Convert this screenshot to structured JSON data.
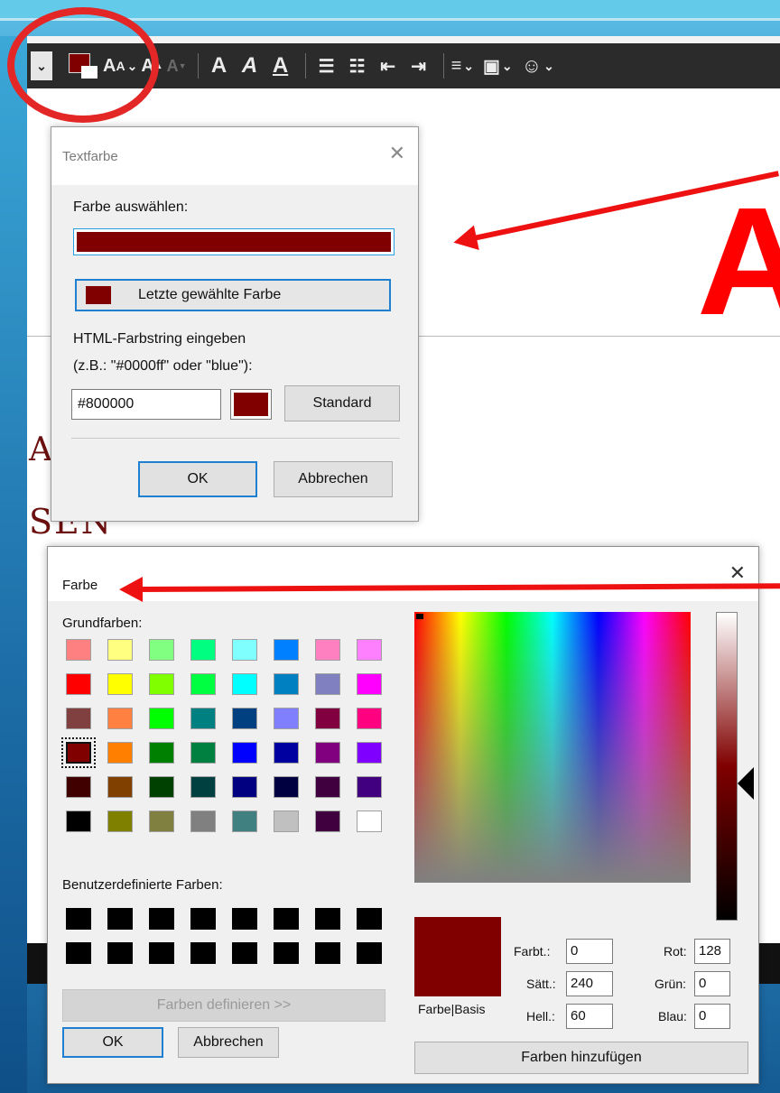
{
  "toolbar": {
    "buttons": [
      "text-color",
      "font-size",
      "grow-font",
      "shrink-font",
      "bold",
      "italic",
      "underline",
      "bullet-list",
      "numbered-list",
      "decrease-indent",
      "increase-indent",
      "align",
      "insert-image",
      "emoji"
    ]
  },
  "background": {
    "big_letter": "A",
    "fragment_1": "A",
    "fragment_2": "SEN"
  },
  "textfarbe_dialog": {
    "title": "Textfarbe",
    "select_label": "Farbe auswählen:",
    "selected_color": "#800000",
    "last_color_button": "Letzte gewählte Farbe",
    "html_label_line1": "HTML-Farbstring eingeben",
    "html_label_line2": "(z.B.: \"#0000ff\" oder \"blue\"):",
    "hex_value": "#800000",
    "standard_button": "Standard",
    "ok_button": "OK",
    "cancel_button": "Abbrechen"
  },
  "farbe_dialog": {
    "title": "Farbe",
    "basic_colors_label": "Grundfarben:",
    "basic_colors": [
      [
        "#ff8080",
        "#ffff80",
        "#80ff80",
        "#00ff80",
        "#80ffff",
        "#0080ff",
        "#ff80c0",
        "#ff80ff"
      ],
      [
        "#ff0000",
        "#ffff00",
        "#80ff00",
        "#00ff40",
        "#00ffff",
        "#0080c0",
        "#8080c0",
        "#ff00ff"
      ],
      [
        "#804040",
        "#ff8040",
        "#00ff00",
        "#008080",
        "#004080",
        "#8080ff",
        "#800040",
        "#ff0080"
      ],
      [
        "#800000",
        "#ff8000",
        "#008000",
        "#008040",
        "#0000ff",
        "#0000a0",
        "#800080",
        "#8000ff"
      ],
      [
        "#400000",
        "#804000",
        "#004000",
        "#004040",
        "#000080",
        "#000040",
        "#400040",
        "#400080"
      ],
      [
        "#000000",
        "#808000",
        "#808040",
        "#808080",
        "#408080",
        "#c0c0c0",
        "#400040",
        "#ffffff"
      ]
    ],
    "selected_basic": "#800000",
    "custom_colors_label": "Benutzerdefinierte Farben:",
    "custom_colors": [
      [
        "#000000",
        "#000000",
        "#000000",
        "#000000",
        "#000000",
        "#000000",
        "#000000",
        "#000000"
      ],
      [
        "#000000",
        "#000000",
        "#000000",
        "#000000",
        "#000000",
        "#000000",
        "#000000",
        "#000000"
      ]
    ],
    "define_button": "Farben definieren >>",
    "ok_button": "OK",
    "cancel_button": "Abbrechen",
    "preview_label": "Farbe|Basis",
    "hue_label": "Farbt.:",
    "hue_value": "0",
    "sat_label": "Sätt.:",
    "sat_value": "240",
    "lum_label": "Hell.:",
    "lum_value": "60",
    "red_label": "Rot:",
    "red_value": "128",
    "green_label": "Grün:",
    "green_value": "0",
    "blue_label": "Blau:",
    "blue_value": "0",
    "add_button": "Farben hinzufügen"
  }
}
